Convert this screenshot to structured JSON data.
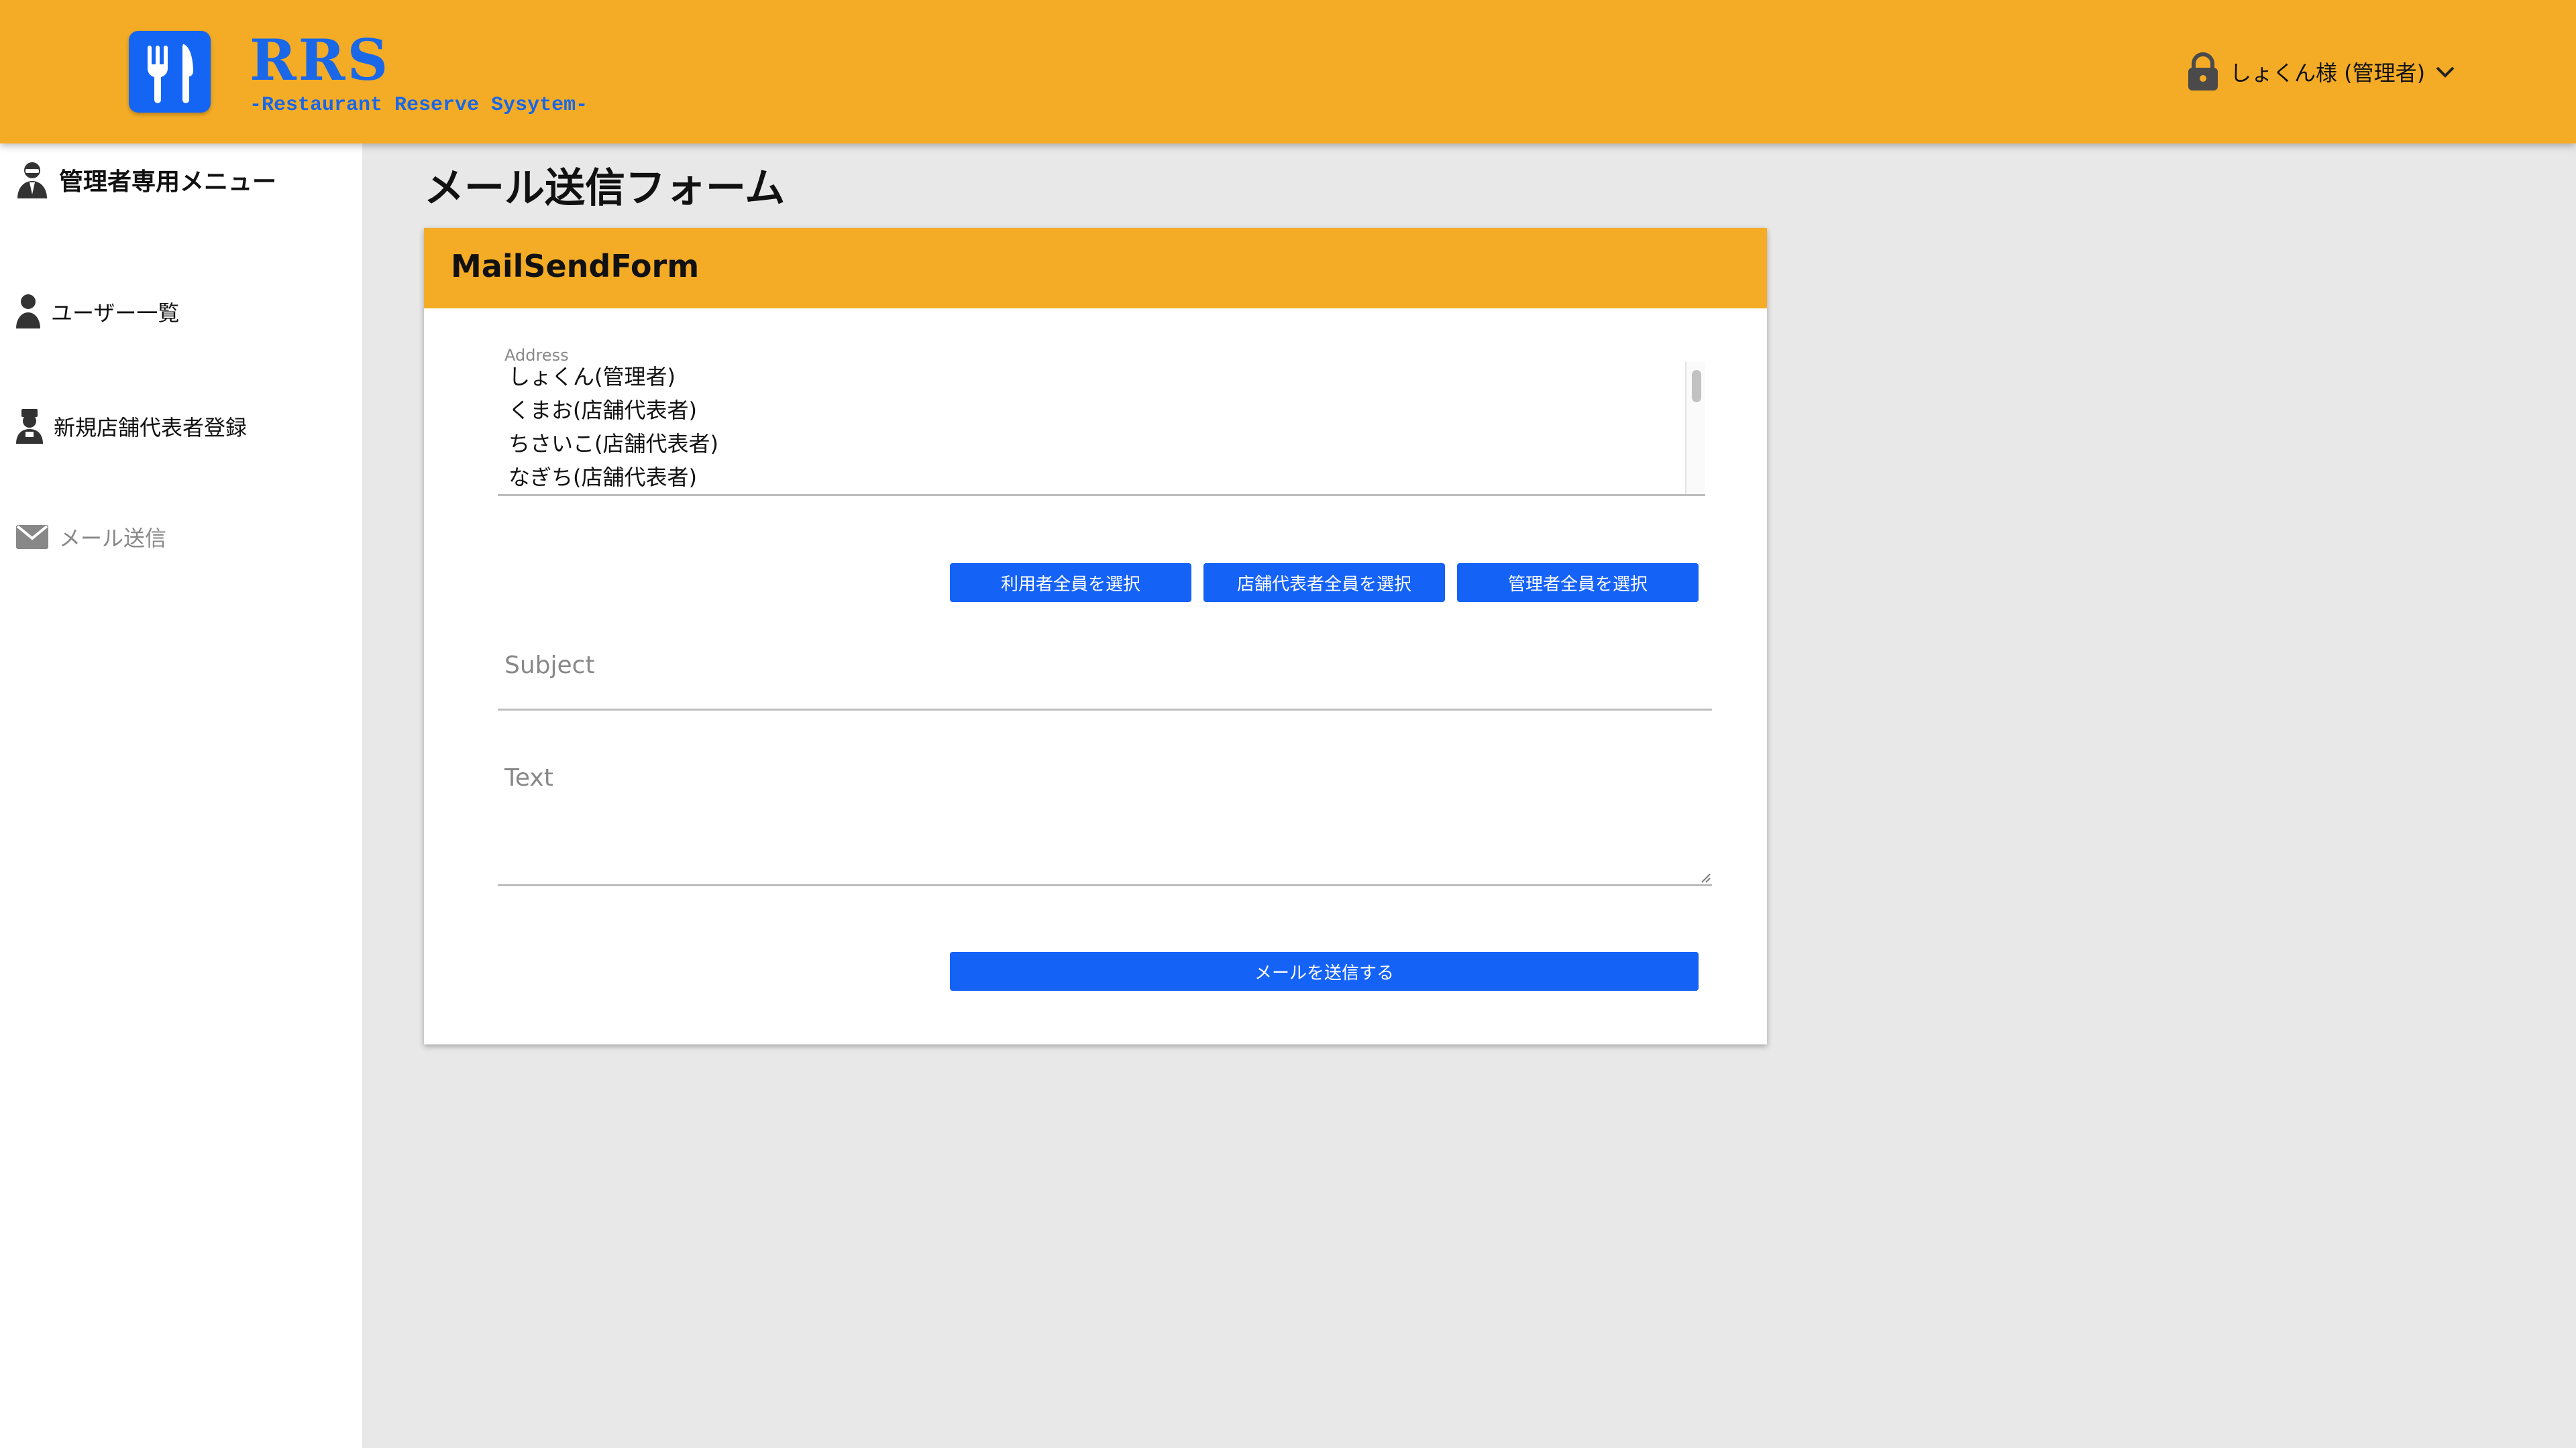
{
  "header": {
    "brand_title": "RRS",
    "brand_subtitle": "-Restaurant Reserve Sysytem-",
    "logo_icon": "fork-knife-icon",
    "user_label": "しょくん様 (管理者)",
    "accent_color": "#f4ac26",
    "brand_color": "#1565f5"
  },
  "sidebar": {
    "heading": "管理者専用メニュー",
    "items": [
      {
        "label": "ユーザー一覧",
        "icon": "user-icon"
      },
      {
        "label": "新規店舗代表者登録",
        "icon": "shop-owner-icon"
      },
      {
        "label": "メール送信",
        "icon": "mail-icon"
      }
    ]
  },
  "main": {
    "page_title": "メール送信フォーム",
    "card_title": "MailSendForm",
    "address_label": "Address",
    "addresses": [
      "しょくん(管理者)",
      "くまお(店舗代表者)",
      "ちさいこ(店舗代表者)",
      "なぎち(店舗代表者)"
    ],
    "buttons": {
      "select_users": "利用者全員を選択",
      "select_shops": "店舗代表者全員を選択",
      "select_admins": "管理者全員を選択",
      "send": "メールを送信する"
    },
    "subject_placeholder": "Subject",
    "text_placeholder": "Text",
    "button_color": "#1562f7"
  }
}
